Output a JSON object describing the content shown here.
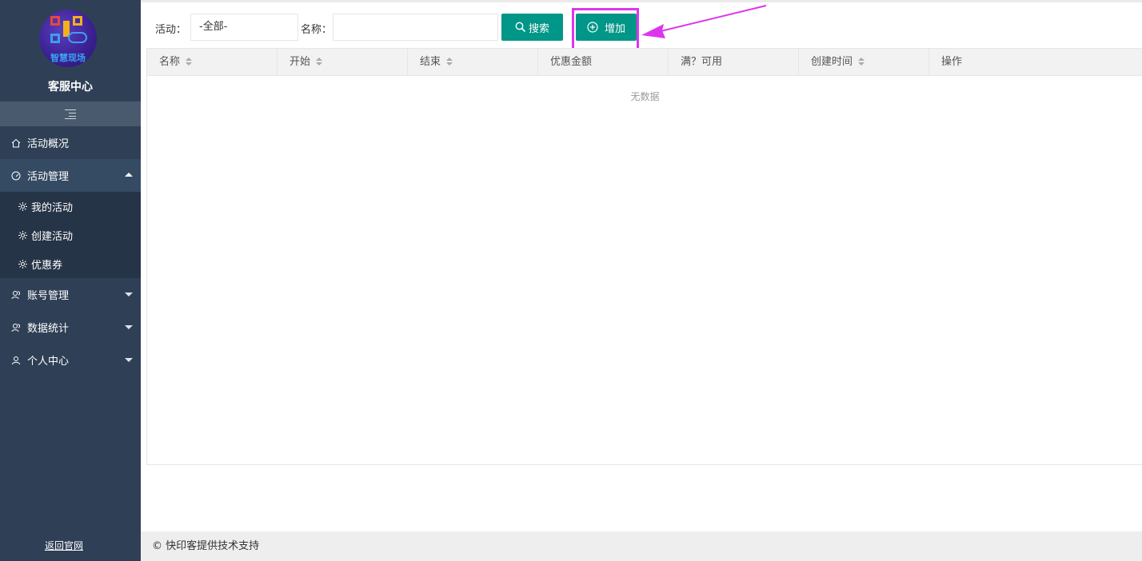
{
  "sidebar": {
    "logo_text": "智慧现场",
    "title": "客服中心",
    "menu": [
      {
        "label": "活动概况",
        "icon": "home-icon"
      },
      {
        "label": "活动管理",
        "icon": "dashboard-icon",
        "expanded": true,
        "children": [
          {
            "label": "我的活动",
            "icon": "gear-icon"
          },
          {
            "label": "创建活动",
            "icon": "gear-icon"
          },
          {
            "label": "优惠券",
            "icon": "gear-icon"
          }
        ]
      },
      {
        "label": "账号管理",
        "icon": "users-icon",
        "expanded": false
      },
      {
        "label": "数据统计",
        "icon": "users-icon",
        "expanded": false
      },
      {
        "label": "个人中心",
        "icon": "user-icon",
        "expanded": false
      }
    ],
    "back_link": "返回官网"
  },
  "filters": {
    "activity_label": "活动：",
    "activity_value": "-全部-",
    "name_label": "名称：",
    "name_value": "",
    "search_label": "搜索",
    "add_label": "增加"
  },
  "table": {
    "columns": [
      {
        "label": "名称",
        "sortable": true
      },
      {
        "label": "开始",
        "sortable": true
      },
      {
        "label": "结束",
        "sortable": true
      },
      {
        "label": "优惠金额",
        "sortable": false
      },
      {
        "label": "满？可用",
        "sortable": false
      },
      {
        "label": "创建时间",
        "sortable": true
      },
      {
        "label": "操作",
        "sortable": false
      }
    ],
    "empty_text": "无数据"
  },
  "footer": {
    "text": "© 快印客提供技术支持"
  },
  "colors": {
    "sidebar_bg": "#2f4056",
    "primary": "#009688",
    "highlight": "#dd35ee"
  }
}
